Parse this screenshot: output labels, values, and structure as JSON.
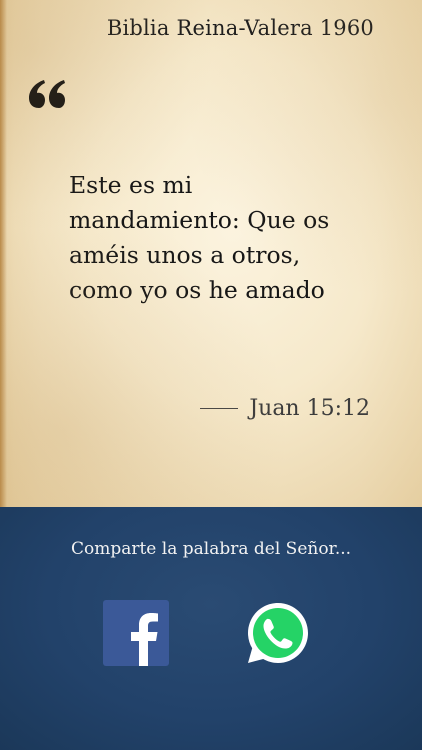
{
  "app": {
    "title": "Biblia Reina-Valera 1960"
  },
  "quote": {
    "mark_icon": "opening-quote-icon",
    "text": "Este es mi\nmandamiento: Que os\naméis unos a otros,\ncomo yo os he amado",
    "reference": "Juan 15:12"
  },
  "share": {
    "prompt": "Comparte la palabra del Señor...",
    "buttons": [
      {
        "id": "facebook",
        "icon": "facebook-icon",
        "color": "#3b5998"
      },
      {
        "id": "whatsapp",
        "icon": "whatsapp-icon",
        "color": "#25d366"
      }
    ]
  },
  "colors": {
    "paper": "#f5e8c9",
    "panel": "#22426a",
    "text": "#161616"
  }
}
